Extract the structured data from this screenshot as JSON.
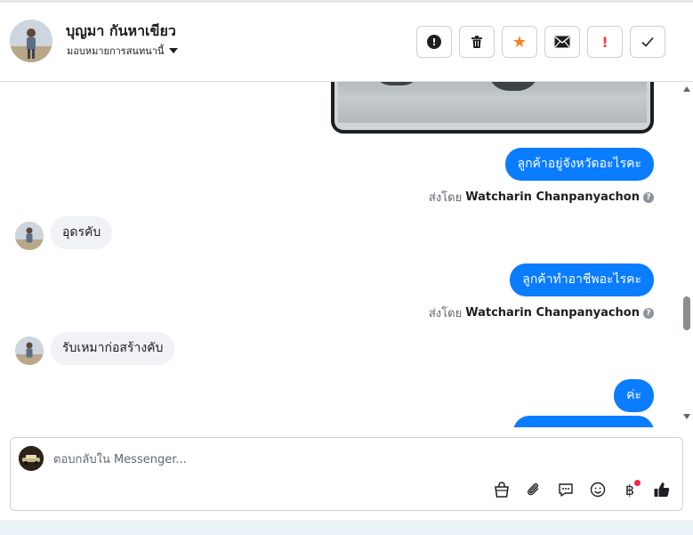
{
  "header": {
    "contact_name": "บุญมา กันหาเขียว",
    "assign_label": "มอบหมายการสนทนานี้",
    "actions": [
      {
        "name": "mark-spam-button",
        "icon": "alert-circle-icon"
      },
      {
        "name": "delete-button",
        "icon": "trash-icon"
      },
      {
        "name": "star-button",
        "icon": "star-icon"
      },
      {
        "name": "mark-unread-button",
        "icon": "envelope-icon"
      },
      {
        "name": "follow-up-button",
        "icon": "exclamation-icon"
      },
      {
        "name": "mark-done-button",
        "icon": "check-icon"
      }
    ]
  },
  "messages": {
    "out1": "ลูกค้าอยู่จังหวัดอะไรคะ",
    "sent_by_prefix": "ส่งโดย",
    "sender": "Watcharin Chanpanyachon",
    "in1": "อุดรคับ",
    "out2": "ลูกค้าทำอาชีพอะไรคะ",
    "in2": "รับเหมาก่อสร้างคับ",
    "out3": "ค่ะ"
  },
  "composer": {
    "placeholder": "ตอบกลับใน Messenger...",
    "icons": [
      "shopping-bag-icon",
      "paperclip-icon",
      "saved-reply-icon",
      "emoji-icon",
      "baht-payment-icon",
      "thumbs-up-icon"
    ]
  },
  "colors": {
    "outgoing_bubble": "#0a7cff",
    "incoming_bubble": "#f0f2f5",
    "star": "#f5821f",
    "notification_dot": "#f02849"
  }
}
